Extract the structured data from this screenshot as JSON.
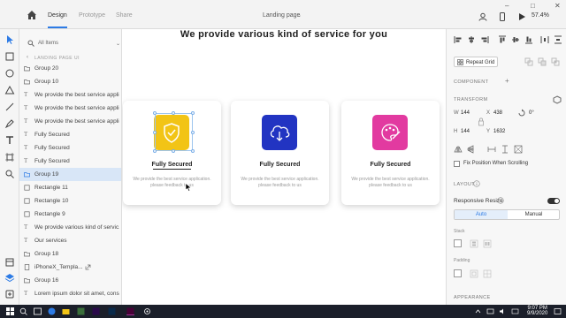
{
  "titlebar": {
    "tabs": [
      {
        "label": "Design",
        "active": true
      },
      {
        "label": "Prototype",
        "active": false
      },
      {
        "label": "Share",
        "active": false
      }
    ],
    "document_title": "Landing page",
    "zoom": "57.4%"
  },
  "layers": {
    "search_placeholder": "All Items",
    "breadcrumb": "LANDING PAGE UI",
    "items": [
      {
        "label": "Group 20",
        "kind": "group"
      },
      {
        "label": "Group 10",
        "kind": "group"
      },
      {
        "label": "We provide the best service applic...",
        "kind": "text"
      },
      {
        "label": "We provide the best service applic...",
        "kind": "text"
      },
      {
        "label": "We provide the best service applic...",
        "kind": "text"
      },
      {
        "label": "Fully Secured",
        "kind": "text"
      },
      {
        "label": "Fully Secured",
        "kind": "text"
      },
      {
        "label": "Fully Secured",
        "kind": "text"
      },
      {
        "label": "Group 19",
        "kind": "group",
        "selected": true
      },
      {
        "label": "Rectangle 11",
        "kind": "rect"
      },
      {
        "label": "Rectangle 10",
        "kind": "rect"
      },
      {
        "label": "Rectangle 9",
        "kind": "rect"
      },
      {
        "label": "We provide various kind of servic...",
        "kind": "text"
      },
      {
        "label": "Our services",
        "kind": "text"
      },
      {
        "label": "Group 18",
        "kind": "group"
      },
      {
        "label": "iPhoneX_Templa...",
        "kind": "link"
      },
      {
        "label": "Group 16",
        "kind": "group"
      },
      {
        "label": "Lorem ipsum dolor sit amet, cons...",
        "kind": "text"
      }
    ]
  },
  "canvas": {
    "heading": "We provide various kind of service for you",
    "cards": [
      {
        "title": "Fully Secured",
        "desc": "We provide the best service application. please feedback to us",
        "icon": "shield-check-icon",
        "color": "#f2c416"
      },
      {
        "title": "Fully Secured",
        "desc": "We provide the best service application. please feedback to us",
        "icon": "cloud-download-icon",
        "color": "#2234c2"
      },
      {
        "title": "Fully Secured",
        "desc": "We provide the best service application. please feedback to us",
        "icon": "palette-icon",
        "color": "#e23aa0"
      }
    ]
  },
  "props": {
    "repeat_grid": "Repeat Grid",
    "component": "COMPONENT",
    "transform": "TRANSFORM",
    "w_label": "W",
    "w_value": "144",
    "x_label": "X",
    "x_value": "438",
    "rotation": "0°",
    "h_label": "H",
    "h_value": "144",
    "y_label": "Y",
    "y_value": "1632",
    "fix_position": "Fix Position When Scrolling",
    "layout": "LAYOUT",
    "responsive_resize": "Responsive Resize",
    "auto": "Auto",
    "manual": "Manual",
    "stack": "Stack",
    "padding": "Padding",
    "appearance": "APPEARANCE"
  },
  "taskbar": {
    "time": "9:07 PM",
    "date": "9/9/2020"
  },
  "colors": {
    "accent": "#2d7be5",
    "selection_bg": "#d8e6f7"
  }
}
